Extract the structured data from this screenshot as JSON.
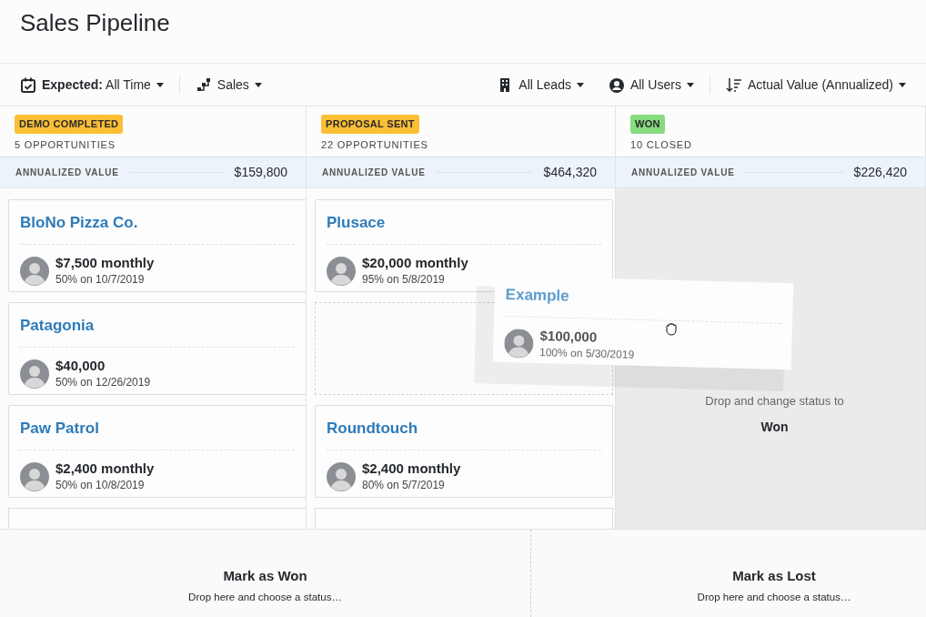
{
  "title": "Sales Pipeline",
  "filters_left": [
    {
      "kind": "date",
      "label": "**Expected:** All Time"
    },
    {
      "kind": "pipeline",
      "label": "Sales"
    }
  ],
  "filters_right": [
    {
      "kind": "lead",
      "label": "All Leads"
    },
    {
      "kind": "user",
      "label": "All Users"
    },
    {
      "kind": "sort",
      "label": "Actual Value (Annualized)"
    }
  ],
  "stages": [
    {
      "name": "DEMO COMPLETED",
      "color": "#fbbf35",
      "count": "5 OPPORTUNITIES",
      "value_label": "ANNUALIZED VALUE",
      "value": "$159,800",
      "drop_target": false,
      "cards": [
        {
          "kind": "deal",
          "title": "BloNo Pizza Co.",
          "amount": "$7,500 monthly",
          "detail": "50% on 10/7/2019"
        },
        {
          "kind": "deal",
          "title": "Patagonia",
          "amount": "$40,000",
          "detail": "50% on 12/26/2019"
        },
        {
          "kind": "deal",
          "title": "Paw Patrol",
          "amount": "$2,400 monthly",
          "detail": "50% on 10/8/2019"
        },
        {
          "kind": "stub"
        }
      ]
    },
    {
      "name": "PROPOSAL SENT",
      "color": "#fbbf35",
      "count": "22 OPPORTUNITIES",
      "value_label": "ANNUALIZED VALUE",
      "value": "$464,320",
      "drop_target": false,
      "cards": [
        {
          "kind": "deal",
          "title": "Plusace",
          "amount": "$20,000 monthly",
          "detail": "95% on 5/8/2019"
        },
        {
          "kind": "placeholder"
        },
        {
          "kind": "deal",
          "title": "Roundtouch",
          "amount": "$2,400 monthly",
          "detail": "80% on 5/7/2019"
        },
        {
          "kind": "stub"
        }
      ]
    },
    {
      "name": "WON",
      "color": "#86dc7f",
      "count": "10 CLOSED",
      "value_label": "ANNUALIZED VALUE",
      "value": "$226,420",
      "drop_target": true,
      "drop_hint": "Drop and change status to",
      "drop_status": "Won"
    }
  ],
  "dragging": {
    "title": "Example",
    "amount": "$100,000",
    "detail": "100% on 5/30/2019"
  },
  "drop_zones": [
    {
      "title": "Mark as Won",
      "hint": "Drop here and choose a status…"
    },
    {
      "title": "Mark as Lost",
      "hint": "Drop here and choose a status…"
    }
  ]
}
